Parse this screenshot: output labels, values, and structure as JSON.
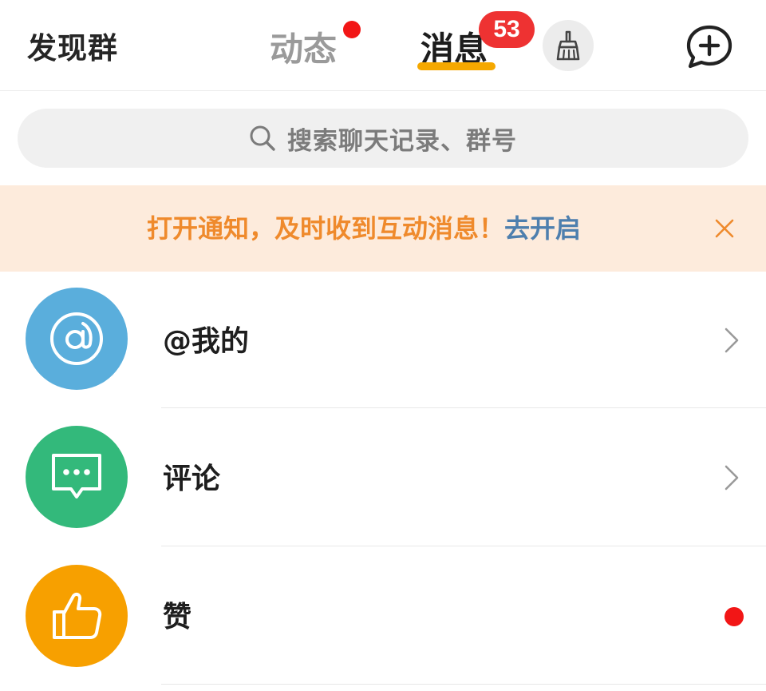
{
  "header": {
    "discover_groups": "发现群",
    "tabs": [
      {
        "label": "动态",
        "active": false,
        "has_dot": true
      },
      {
        "label": "消息",
        "active": true,
        "badge": "53"
      }
    ],
    "clean_icon": "broom-icon",
    "compose_icon": "add-chat-icon"
  },
  "search": {
    "placeholder": "搜索聊天记录、群号",
    "icon": "search-icon"
  },
  "notification_banner": {
    "message": "打开通知，及时收到互动消息！",
    "action_label": "去开启",
    "close_icon": "close-icon"
  },
  "list": {
    "items": [
      {
        "label": "@我的",
        "icon": "at-icon",
        "color": "#5aaedc",
        "trailing": "chevron-right-icon"
      },
      {
        "label": "评论",
        "icon": "comment-icon",
        "color": "#33b97b",
        "trailing": "chevron-right-icon"
      },
      {
        "label": "赞",
        "icon": "thumbs-up-icon",
        "color": "#f7a000",
        "trailing": "unread-dot"
      }
    ]
  },
  "colors": {
    "accent_orange": "#f5a800",
    "badge_red": "#ee3232",
    "banner_bg": "#fdebdc",
    "banner_text": "#ef8a2c",
    "link_blue": "#4e7fae"
  }
}
